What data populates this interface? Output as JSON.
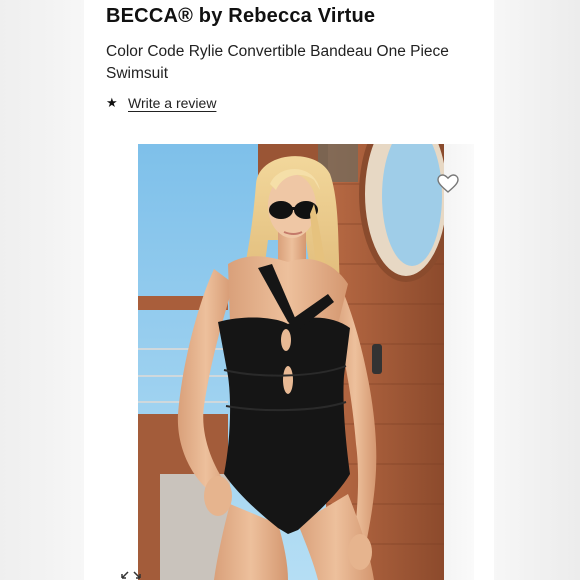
{
  "product": {
    "brand": "BECCA® by Rebecca Virtue",
    "title": "Color Code Rylie Convertible Bandeau One Piece Swimsuit",
    "review_link": "Write a review"
  },
  "icons": {
    "star": "star-icon",
    "heart": "heart-icon",
    "expand": "expand-icon"
  },
  "colors": {
    "text": "#111111",
    "background": "#ffffff",
    "swimsuit": "#141414",
    "sky": "#8fc9ea",
    "wood": "#a45d3c"
  }
}
